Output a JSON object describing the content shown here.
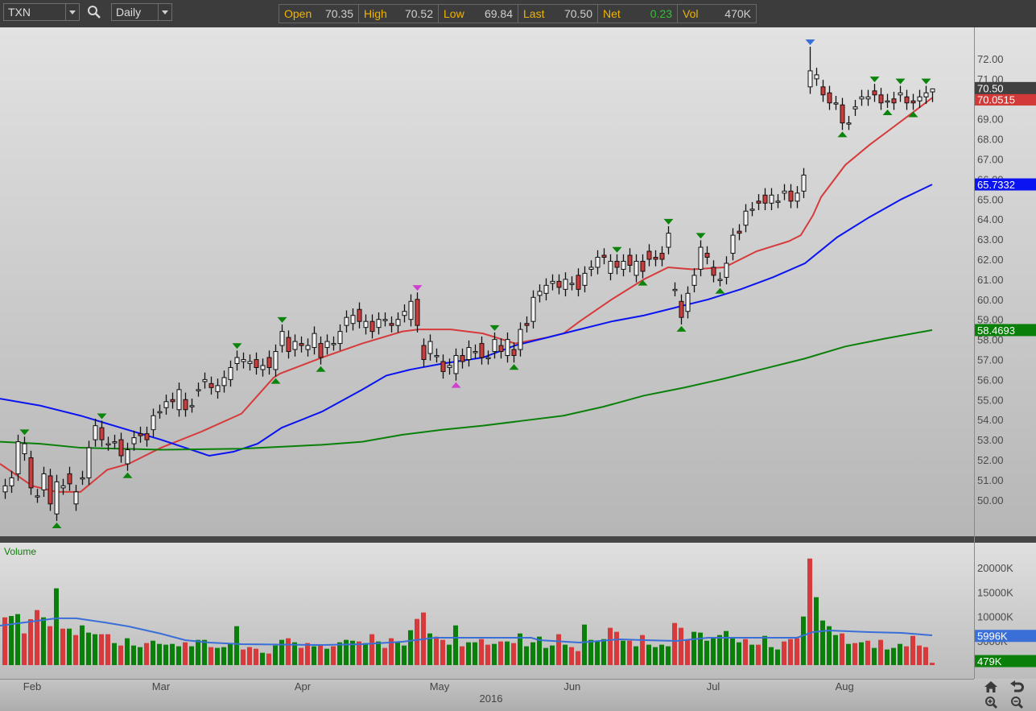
{
  "toolbar": {
    "symbol": "TXN",
    "interval": "Daily"
  },
  "quote": [
    {
      "label": "Open",
      "value": "70.35"
    },
    {
      "label": "High",
      "value": "70.52"
    },
    {
      "label": "Low",
      "value": "69.84"
    },
    {
      "label": "Last",
      "value": "70.50"
    },
    {
      "label": "Net",
      "value": "0.23"
    },
    {
      "label": "Vol",
      "value": "470K"
    }
  ],
  "colors": {
    "up_body": "#f2f2f2",
    "down_body": "#d23a3a",
    "marker_green": "#0a840a",
    "marker_magenta": "#d040d0",
    "marker_blue": "#3a6fd8",
    "vol_up": "#0a800a",
    "vol_down": "#d63a3a",
    "vol_ma": "#3a6fd8"
  },
  "chart_data": {
    "type": "candlestick",
    "symbol": "TXN",
    "interval": "Daily",
    "year_label": "2016",
    "months": [
      {
        "label": "Feb",
        "bar": 4.25
      },
      {
        "label": "Mar",
        "bar": 24.25
      },
      {
        "label": "Apr",
        "bar": 46.25
      },
      {
        "label": "May",
        "bar": 67.5
      },
      {
        "label": "Jun",
        "bar": 88.1
      },
      {
        "label": "Jul",
        "bar": 110
      },
      {
        "label": "Aug",
        "bar": 130.4
      }
    ],
    "price_axis": {
      "ticks": [
        "50.00",
        "51.00",
        "52.00",
        "53.00",
        "54.00",
        "55.00",
        "56.00",
        "57.00",
        "58.00",
        "59.00",
        "60.00",
        "61.00",
        "62.00",
        "63.00",
        "64.00",
        "65.00",
        "66.00",
        "67.00",
        "68.00",
        "69.00",
        "70.00",
        "71.00",
        "72.00"
      ]
    },
    "open": [
      50.4,
      50.7,
      51.3,
      52.3,
      52.1,
      50.2,
      50.5,
      51.2,
      49.3,
      50.6,
      51.3,
      49.8,
      51.1,
      51.1,
      53.0,
      53.6,
      52.8,
      52.9,
      53.0,
      51.8,
      52.8,
      53.3,
      53.3,
      53.5,
      54.4,
      54.6,
      55.0,
      54.5,
      55.0,
      54.7,
      55.5,
      55.9,
      55.8,
      55.4,
      55.7,
      56.0,
      56.8,
      56.9,
      56.8,
      57.0,
      56.5,
      57.1,
      56.5,
      57.7,
      58.1,
      57.5,
      57.8,
      57.5,
      57.6,
      57.8,
      57.6,
      57.8,
      57.8,
      58.7,
      58.8,
      59.5,
      58.6,
      58.9,
      58.6,
      59.0,
      58.8,
      58.7,
      59.2,
      59.0,
      60.0,
      57.7,
      57.3,
      57.2,
      56.9,
      56.6,
      56.3,
      57.2,
      57.0,
      57.4,
      57.8,
      57.1,
      57.4,
      57.7,
      57.2,
      57.5,
      57.5,
      58.8,
      58.9,
      60.2,
      60.3,
      60.8,
      60.9,
      60.5,
      60.8,
      61.2,
      60.7,
      61.5,
      61.6,
      62.2,
      61.3,
      61.9,
      61.5,
      62.2,
      61.2,
      61.9,
      62.4,
      62.1,
      62.3,
      62.6,
      60.5,
      59.9,
      59.4,
      60.7,
      61.5,
      62.3,
      61.6,
      61.0,
      61.1,
      62.3,
      63.4,
      63.7,
      64.5,
      64.9,
      65.2,
      64.8,
      64.9,
      65.3,
      65.4,
      64.9,
      65.4,
      70.6,
      71.0,
      70.6,
      70.3,
      69.8,
      69.7,
      68.8,
      69.5,
      70.0,
      70.0,
      70.4,
      70.2,
      69.9,
      70.0,
      70.2,
      70.1,
      69.9,
      69.9,
      70.1,
      70.35
    ],
    "close": [
      50.7,
      51.1,
      52.9,
      52.8,
      50.6,
      50.2,
      51.3,
      49.8,
      50.9,
      50.7,
      50.8,
      50.4,
      51.1,
      52.6,
      53.7,
      53.0,
      52.8,
      52.9,
      52.2,
      52.5,
      53.1,
      53.2,
      53.0,
      54.2,
      54.4,
      54.9,
      54.9,
      55.5,
      54.5,
      54.7,
      55.5,
      56.0,
      55.6,
      55.7,
      56.1,
      56.6,
      57.1,
      57.0,
      56.9,
      56.6,
      56.7,
      56.6,
      57.4,
      58.4,
      57.4,
      57.9,
      57.7,
      57.7,
      58.3,
      57.1,
      57.9,
      57.8,
      58.4,
      59.1,
      59.2,
      58.9,
      58.9,
      58.4,
      59.0,
      59.0,
      58.7,
      59.0,
      59.4,
      59.9,
      58.7,
      57.0,
      57.9,
      57.2,
      56.4,
      56.7,
      57.2,
      56.9,
      57.6,
      57.4,
      57.1,
      57.1,
      58.0,
      57.4,
      58.0,
      57.2,
      58.5,
      58.7,
      60.1,
      60.4,
      60.7,
      60.9,
      60.6,
      61.0,
      60.8,
      60.5,
      61.3,
      61.6,
      62.1,
      62.1,
      61.9,
      61.6,
      61.9,
      61.7,
      61.9,
      61.4,
      62.0,
      62.0,
      62.0,
      63.3,
      60.5,
      59.1,
      60.3,
      61.2,
      62.6,
      62.1,
      61.2,
      61.0,
      61.8,
      63.2,
      63.3,
      64.4,
      64.5,
      64.8,
      64.8,
      65.2,
      64.9,
      65.4,
      64.9,
      65.3,
      66.2,
      71.4,
      71.2,
      70.2,
      69.8,
      69.8,
      68.8,
      68.8,
      69.6,
      70.1,
      70.1,
      70.2,
      69.8,
      69.9,
      69.8,
      70.3,
      69.8,
      69.8,
      70.1,
      70.3,
      70.5
    ],
    "high_overrides": {
      "125": 72.6,
      "144": 70.52
    },
    "low_overrides": {
      "144": 69.84
    },
    "last_price": "70.50",
    "moving_averages": [
      {
        "name": "MA 20",
        "color": "#d63a3a",
        "last": "70.0515",
        "points": [
          [
            -0.75,
            51.8
          ],
          [
            4.25,
            50.7
          ],
          [
            8,
            50.4
          ],
          [
            11.75,
            50.4
          ],
          [
            15.9,
            51.5
          ],
          [
            19.25,
            51.8
          ],
          [
            24.25,
            52.6
          ],
          [
            30.5,
            53.4
          ],
          [
            36.75,
            54.3
          ],
          [
            41.75,
            56.1
          ],
          [
            42.75,
            56.3
          ],
          [
            49.25,
            57.1
          ],
          [
            55.5,
            57.8
          ],
          [
            61.75,
            58.4
          ],
          [
            64.25,
            58.5
          ],
          [
            69.25,
            58.5
          ],
          [
            74.25,
            58.3
          ],
          [
            79.25,
            57.8
          ],
          [
            84.25,
            58.1
          ],
          [
            86.75,
            58.3
          ],
          [
            89.25,
            58.9
          ],
          [
            94.25,
            60.0
          ],
          [
            99.25,
            61.0
          ],
          [
            103,
            61.6
          ],
          [
            106.75,
            61.5
          ],
          [
            111.75,
            61.6
          ],
          [
            116.75,
            62.4
          ],
          [
            121.75,
            62.9
          ],
          [
            123.6,
            63.2
          ],
          [
            125.5,
            64.2
          ],
          [
            126.75,
            65.1
          ],
          [
            130.5,
            66.7
          ],
          [
            134.25,
            67.7
          ],
          [
            136.75,
            68.3
          ],
          [
            140.5,
            69.2
          ],
          [
            144,
            70.05
          ]
        ]
      },
      {
        "name": "MA 50",
        "color": "#0a14f0",
        "last": "65.7332",
        "points": [
          [
            -0.75,
            55.05
          ],
          [
            5.5,
            54.7
          ],
          [
            11.75,
            54.2
          ],
          [
            18,
            53.6
          ],
          [
            24.25,
            53.0
          ],
          [
            31.75,
            52.2
          ],
          [
            35.5,
            52.4
          ],
          [
            39.25,
            52.8
          ],
          [
            43,
            53.6
          ],
          [
            49.25,
            54.4
          ],
          [
            55.5,
            55.5
          ],
          [
            59.25,
            56.2
          ],
          [
            63,
            56.5
          ],
          [
            68,
            56.8
          ],
          [
            74.25,
            57.1
          ],
          [
            79.25,
            57.7
          ],
          [
            84.25,
            58.1
          ],
          [
            89.25,
            58.5
          ],
          [
            94.25,
            58.9
          ],
          [
            99.25,
            59.2
          ],
          [
            104.25,
            59.6
          ],
          [
            109.25,
            60.0
          ],
          [
            114.25,
            60.5
          ],
          [
            119.25,
            61.1
          ],
          [
            124.25,
            61.8
          ],
          [
            129.25,
            63.1
          ],
          [
            134.25,
            64.1
          ],
          [
            139.25,
            65.0
          ],
          [
            144,
            65.73
          ]
        ]
      },
      {
        "name": "MA 200",
        "color": "#0a800a",
        "last": "58.4693",
        "points": [
          [
            -0.75,
            52.9
          ],
          [
            5.5,
            52.8
          ],
          [
            11.75,
            52.6
          ],
          [
            18,
            52.55
          ],
          [
            24.25,
            52.5
          ],
          [
            36.75,
            52.55
          ],
          [
            49.25,
            52.75
          ],
          [
            55.5,
            52.9
          ],
          [
            61.75,
            53.25
          ],
          [
            68,
            53.5
          ],
          [
            74.25,
            53.7
          ],
          [
            80.5,
            53.95
          ],
          [
            86.75,
            54.2
          ],
          [
            93,
            54.65
          ],
          [
            99.25,
            55.2
          ],
          [
            105.5,
            55.6
          ],
          [
            111.75,
            56.05
          ],
          [
            118,
            56.55
          ],
          [
            124.25,
            57.05
          ],
          [
            130.5,
            57.65
          ],
          [
            136.75,
            58.05
          ],
          [
            144,
            58.47
          ]
        ]
      }
    ],
    "markers": [
      {
        "bar": 3,
        "pos": "above",
        "color": "green"
      },
      {
        "bar": 15,
        "pos": "above",
        "color": "green"
      },
      {
        "bar": 36,
        "pos": "above",
        "color": "green"
      },
      {
        "bar": 43,
        "pos": "above",
        "color": "green"
      },
      {
        "bar": 76,
        "pos": "above",
        "color": "green"
      },
      {
        "bar": 95,
        "pos": "above",
        "color": "green"
      },
      {
        "bar": 103,
        "pos": "above",
        "color": "green"
      },
      {
        "bar": 108,
        "pos": "above",
        "color": "green"
      },
      {
        "bar": 135,
        "pos": "above",
        "color": "green"
      },
      {
        "bar": 139,
        "pos": "above",
        "color": "green"
      },
      {
        "bar": 143,
        "pos": "above",
        "color": "green"
      },
      {
        "bar": 8,
        "pos": "below",
        "color": "green"
      },
      {
        "bar": 19,
        "pos": "below",
        "color": "green"
      },
      {
        "bar": 42,
        "pos": "below",
        "color": "green"
      },
      {
        "bar": 49,
        "pos": "below",
        "color": "green"
      },
      {
        "bar": 79,
        "pos": "below",
        "color": "green"
      },
      {
        "bar": 99,
        "pos": "below",
        "color": "green"
      },
      {
        "bar": 105,
        "pos": "below",
        "color": "green"
      },
      {
        "bar": 111,
        "pos": "below",
        "color": "green"
      },
      {
        "bar": 130,
        "pos": "below",
        "color": "green"
      },
      {
        "bar": 137,
        "pos": "below",
        "color": "green"
      },
      {
        "bar": 141,
        "pos": "below",
        "color": "green"
      },
      {
        "bar": 64,
        "pos": "above",
        "color": "magenta"
      },
      {
        "bar": 70,
        "pos": "below",
        "color": "magenta"
      },
      {
        "bar": 125,
        "pos": "above",
        "color": "blue"
      }
    ],
    "volume": {
      "label": "Volume",
      "unit": "K",
      "ticks": [
        "20000K",
        "15000K",
        "10000K",
        "5000K"
      ],
      "values": [
        9800,
        10080,
        10470,
        6500,
        9420,
        11300,
        9800,
        7990,
        15760,
        7490,
        7490,
        6170,
        8150,
        6670,
        6340,
        6340,
        6340,
        4520,
        4020,
        5510,
        4020,
        3690,
        4520,
        5010,
        4350,
        4190,
        4350,
        3860,
        4680,
        3860,
        5180,
        5180,
        3690,
        3530,
        3690,
        4350,
        7990,
        3200,
        3690,
        3360,
        2530,
        2370,
        4020,
        5180,
        5510,
        4680,
        3530,
        4520,
        3860,
        4020,
        3360,
        3860,
        4680,
        5180,
        5010,
        4850,
        4520,
        6340,
        4850,
        3530,
        5510,
        4850,
        4020,
        7160,
        9480,
        10800,
        6500,
        5840,
        5180,
        4190,
        8150,
        3860,
        4680,
        4680,
        5340,
        4190,
        4350,
        4850,
        4850,
        4520,
        6500,
        3860,
        4680,
        5840,
        3530,
        4020,
        6340,
        4190,
        3690,
        2870,
        8320,
        5180,
        4850,
        5340,
        7660,
        6830,
        5010,
        5010,
        3860,
        6170,
        4190,
        3690,
        4190,
        3860,
        8650,
        7660,
        5180,
        6830,
        6670,
        5010,
        5510,
        6170,
        7000,
        5510,
        4680,
        5340,
        4190,
        4190,
        6000,
        3690,
        3200,
        4850,
        5340,
        5510,
        9970,
        21870,
        13940,
        9150,
        7990,
        6170,
        6500,
        4350,
        4520,
        4680,
        5010,
        3530,
        5180,
        3200,
        3530,
        4350,
        3860,
        6000,
        4020,
        3690,
        479
      ],
      "directions": "rggrrrgrgrgrgggrrgrgggrgggggrgggrggggrrrgrggrgrrgrgrgggrgrgrrgggrrgrrggrggrrgrgrggggggrgrrggggrrgrgrggggrrrggggggggrgrgggrrrgrggggrgrgrgrggg",
      "ma": {
        "last": "5996K",
        "points": [
          [
            -0.75,
            8100
          ],
          [
            8,
            9600
          ],
          [
            11.1,
            9600
          ],
          [
            15.5,
            8760
          ],
          [
            19.25,
            7930
          ],
          [
            24.25,
            6450
          ],
          [
            28,
            5120
          ],
          [
            31.75,
            4630
          ],
          [
            36.75,
            4300
          ],
          [
            49.25,
            4130
          ],
          [
            55.5,
            4300
          ],
          [
            61.75,
            4790
          ],
          [
            66.75,
            5620
          ],
          [
            81.75,
            5620
          ],
          [
            83,
            5120
          ],
          [
            89.25,
            4630
          ],
          [
            95.5,
            5290
          ],
          [
            99.25,
            5120
          ],
          [
            104.25,
            4960
          ],
          [
            109.25,
            5620
          ],
          [
            118,
            5620
          ],
          [
            123,
            5620
          ],
          [
            125.5,
            6780
          ],
          [
            128,
            7100
          ],
          [
            134.25,
            6780
          ],
          [
            139.25,
            6610
          ],
          [
            144,
            6110
          ]
        ]
      },
      "last": "479K"
    }
  }
}
